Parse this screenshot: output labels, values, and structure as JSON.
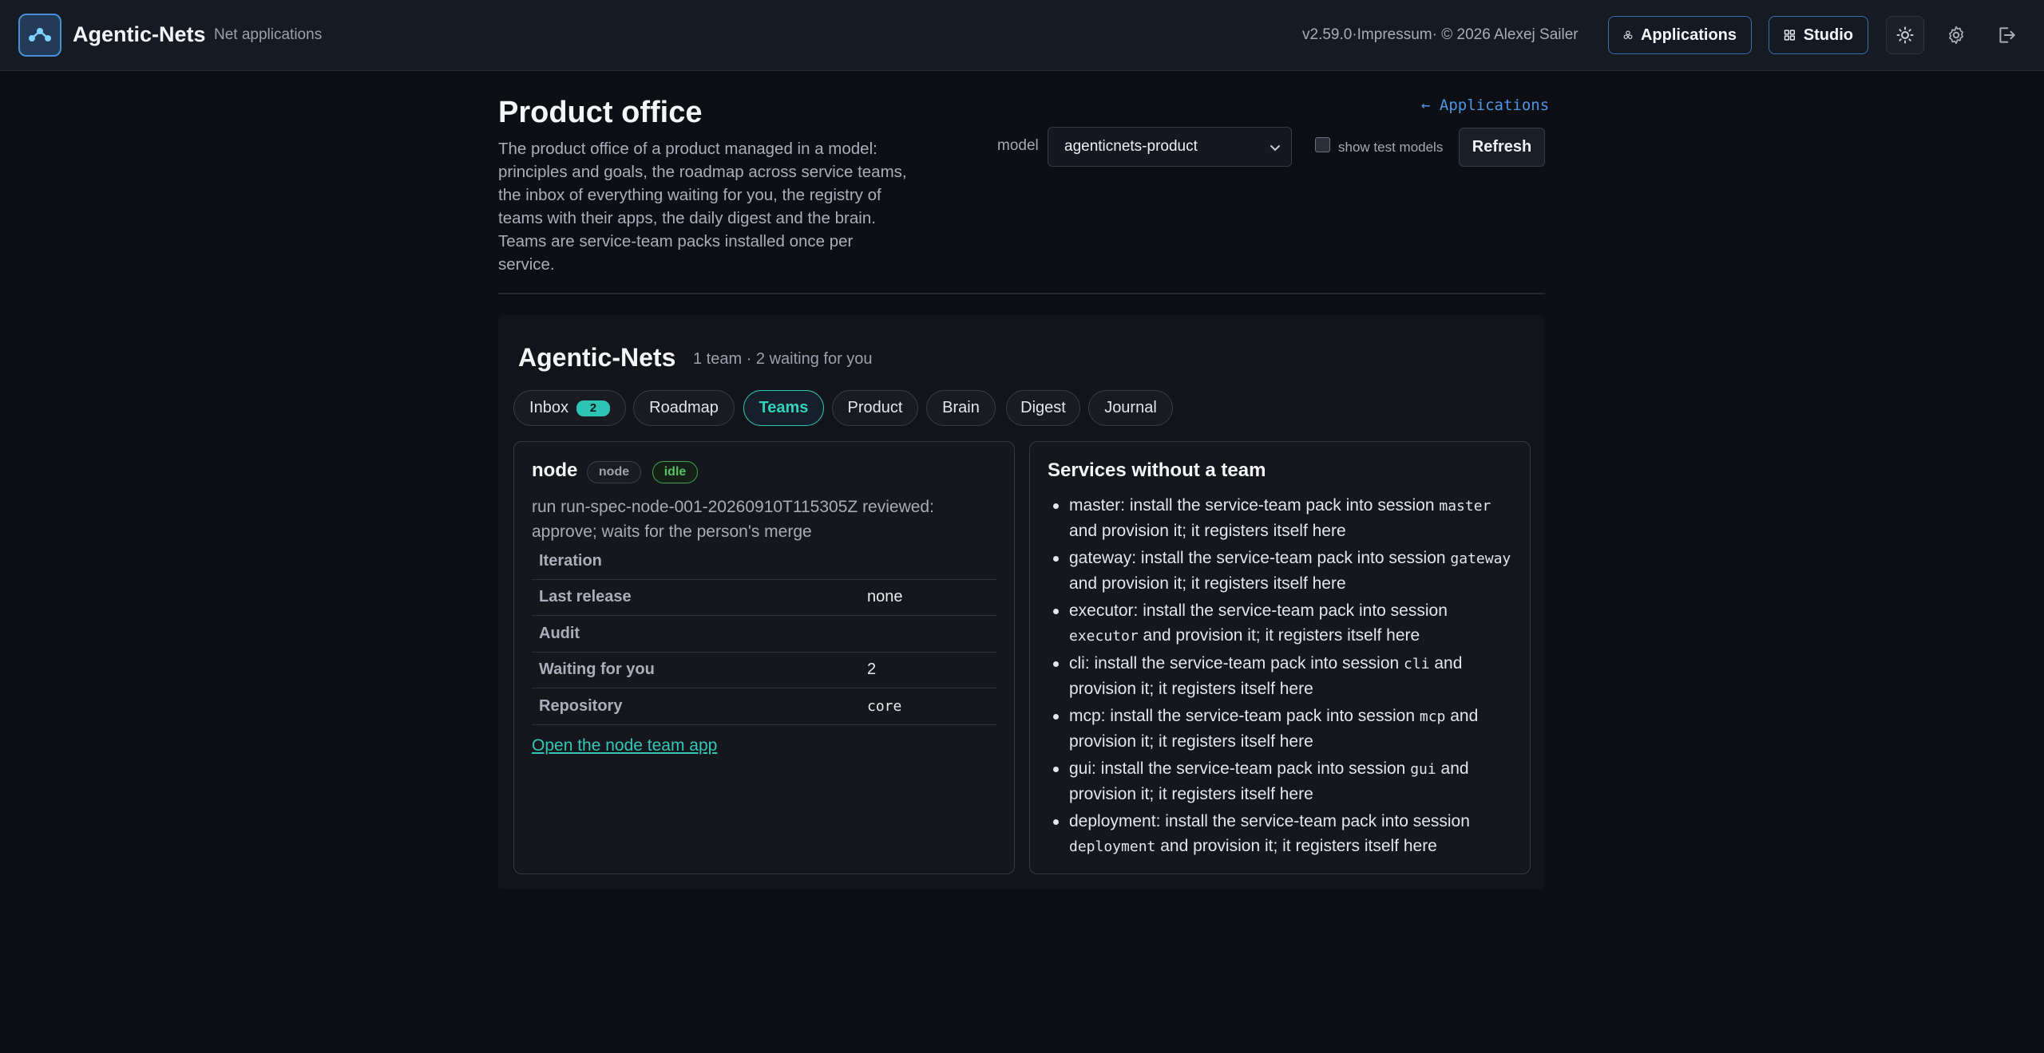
{
  "header": {
    "brand": "Agentic-Nets",
    "subtitle": "Net applications",
    "version": "v2.59.0·Impressum· © 2026 Alexej Sailer",
    "applications_label": "Applications",
    "studio_label": "Studio"
  },
  "page": {
    "title": "Product office",
    "description": "The product office of a product managed in a model: principles and goals, the roadmap across service teams, the inbox of everything waiting for you, the registry of teams with their apps, the daily digest and the brain. Teams are service-team packs installed once per service.",
    "back_link": "← Applications",
    "model_label": "model",
    "model_value": "agenticnets-product",
    "show_test_models_label": "show test models",
    "refresh_label": "Refresh"
  },
  "panel": {
    "title": "Agentic-Nets",
    "summary": "1 team · 2 waiting for you",
    "tabs": [
      {
        "label": "Inbox",
        "badge": "2"
      },
      {
        "label": "Roadmap"
      },
      {
        "label": "Teams"
      },
      {
        "label": "Product"
      },
      {
        "label": "Brain"
      },
      {
        "label": "Digest"
      },
      {
        "label": "Journal"
      }
    ],
    "active_tab": "Teams"
  },
  "team_card": {
    "name": "node",
    "tag": "node",
    "status": "idle",
    "status_color": "#56c266",
    "description": "run run-spec-node-001-20260910T115305Z reviewed: approve; waits for the person's merge",
    "rows": [
      {
        "key": "Iteration",
        "value": ""
      },
      {
        "key": "Last release",
        "value": "none"
      },
      {
        "key": "Audit",
        "value": ""
      },
      {
        "key": "Waiting for you",
        "value": "2"
      },
      {
        "key": "Repository",
        "value": "core"
      }
    ],
    "link": "Open the node team app"
  },
  "services": {
    "title": "Services without a team",
    "items": [
      {
        "pre": "master: install the service-team pack into session ",
        "code": "master",
        "post": " and provision it; it registers itself here"
      },
      {
        "pre": "gateway: install the service-team pack into session ",
        "code": "gateway",
        "post": " and provision it; it registers itself here"
      },
      {
        "pre": "executor: install the service-team pack into session ",
        "code": "executor",
        "post": " and provision it; it registers itself here"
      },
      {
        "pre": "cli: install the service-team pack into session ",
        "code": "cli",
        "post": " and provision it; it registers itself here"
      },
      {
        "pre": "mcp: install the service-team pack into session ",
        "code": "mcp",
        "post": " and provision it; it registers itself here"
      },
      {
        "pre": "gui: install the service-team pack into session ",
        "code": "gui",
        "post": " and provision it; it registers itself here"
      },
      {
        "pre": "deployment: install the service-team pack into session ",
        "code": "deployment",
        "post": " and provision it; it registers itself here"
      }
    ]
  },
  "colors": {
    "accent": "#2fc6b5",
    "link": "#4f95e6",
    "background": "#0d0f14"
  }
}
